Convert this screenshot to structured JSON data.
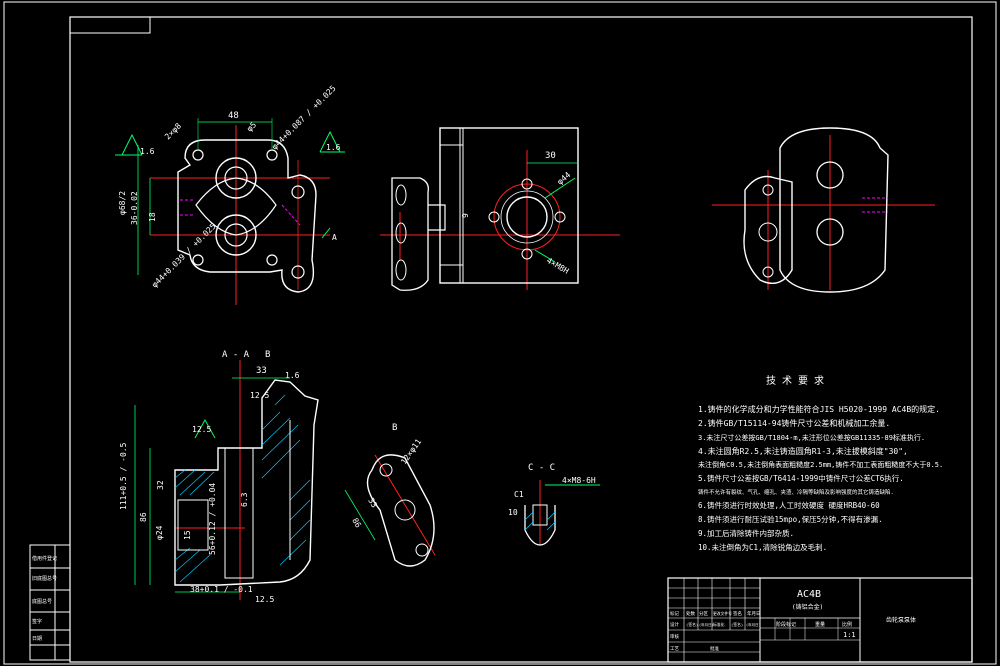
{
  "colors": {
    "background": "#000000",
    "frame": "#ffffff",
    "centerline": "#ff2020",
    "dimension": "#00ff66",
    "hidden": "#ff00ff",
    "hatch": "#00c8ff",
    "text": "#ffffff"
  },
  "top_view": {
    "dims": {
      "width": "48",
      "hole_dia_left": "2×φ8",
      "hole_dia_right": "φ44+0.087 / +0.025",
      "phi5": "φ5",
      "height_left": "φ68/2",
      "bore_center": "36-0.02",
      "height_small": "18",
      "rough_left": "1.6",
      "rough_right": "1.6",
      "bottom_hole": "φ44+0.039 / +0.025",
      "small_a": "A"
    }
  },
  "front_view": {
    "dims": {
      "offset": "30",
      "bolt_circle": "φ44",
      "thread": "4×M8H",
      "gap": "9"
    }
  },
  "section_aa": {
    "title": "A - A",
    "marker_b": "B",
    "dims": {
      "d33": "33",
      "d16": "1.6",
      "d125_top": "12.5",
      "d125_left": "12.5",
      "d111": "111+0.5 / -0.5",
      "d32": "32",
      "d86": "86",
      "phi24": "φ24",
      "d15": "15",
      "d56": "56+0.12 / +0.04",
      "d63": "6.3",
      "d38": "38+0.1 / -0.1",
      "d125_bottom": "12.5"
    }
  },
  "view_b": {
    "title": "B",
    "dims": {
      "phi": "12×φ11",
      "d33": "33",
      "d86": "86"
    }
  },
  "section_cc": {
    "title": "C - C",
    "dims": {
      "thread": "4×M8-6H",
      "c1": "C1",
      "d10": "10"
    }
  },
  "tech_req": {
    "heading": "技 术 要 求",
    "items": [
      "1.铸件的化学成分和力学性能符合JIS H5020-1999 AC4B的规定.",
      "2.铸件GB/T15114-94铸件尺寸公差和机械加工余量.",
      "3.未注尺寸公差按GB/T1804-m,未注形位公差按GB11335-89标准执行.",
      "4.未注圆角R2.5,未注铸造圆角R1-3,未注拔模斜度\"30\",",
      "   未注倒角C0.5,未注倒角表面粗糙度2.5mm,铸件不加工表面粗糙度不大于0.5.",
      "5.铸件尺寸公差按GB/T6414-1999中铸件尺寸公差CT6执行.",
      "   铸件不允许有裂纹、气孔、缩孔、夹渣、冷隔等缺陷及影响强度的其它铸造缺陷.",
      "6.铸件须进行时效处理,人工时效硬度 硬度HRB40-60",
      "8.铸件须进行耐压试验15mpo,保压5分钟,不得有渗漏.",
      "9.加工后清除铸件内部杂质.",
      "10.未注倒角为C1,清除锐角边及毛刺."
    ]
  },
  "title_block": {
    "part_code": "AC4B",
    "part_sub": "(铸铝合金)",
    "drawing_name": "齿轮泵泵体",
    "scale": "1:1",
    "cells_row1": [
      "标记",
      "处数",
      "分区",
      "更改文件号",
      "签名",
      "年月日"
    ],
    "cells_row2": [
      "设计",
      "(签名)",
      "(年月日)",
      "标准化",
      "(签名)",
      "(年月日)"
    ],
    "cells_row3": [
      "审核"
    ],
    "cells_row4": [
      "工艺",
      "批准"
    ],
    "right_labels": [
      "阶段标记",
      "重量",
      "比例"
    ]
  },
  "left_strip": {
    "labels": [
      "借用件登记",
      "旧底图总号",
      "底图总号",
      "签字",
      "日期"
    ]
  }
}
